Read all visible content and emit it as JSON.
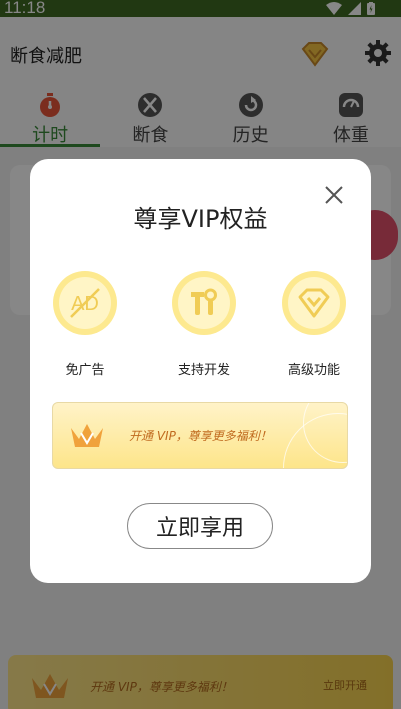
{
  "status_bar": {
    "time": "11:18"
  },
  "app_bar": {
    "title": "断食减肥"
  },
  "tabs": [
    {
      "label": "计时",
      "icon": "stopwatch-icon",
      "active": true
    },
    {
      "label": "断食",
      "icon": "fork-knife-icon",
      "active": false
    },
    {
      "label": "历史",
      "icon": "history-icon",
      "active": false
    },
    {
      "label": "体重",
      "icon": "scale-icon",
      "active": false
    }
  ],
  "bottom_banner": {
    "text": "开通 VIP，尊享更多福利！",
    "button": "立即开通"
  },
  "dialog": {
    "title": "尊享VIP权益",
    "features": [
      {
        "label": "免广告",
        "icon": "no-ads-icon"
      },
      {
        "label": "支持开发",
        "icon": "tools-icon"
      },
      {
        "label": "高级功能",
        "icon": "diamond-icon"
      }
    ],
    "promo_text": "开通 VIP，尊享更多福利！",
    "button": "立即享用"
  },
  "colors": {
    "accent": "#3a8a3a",
    "gold": "#fde98f",
    "status_bar": "#3f6b22"
  }
}
